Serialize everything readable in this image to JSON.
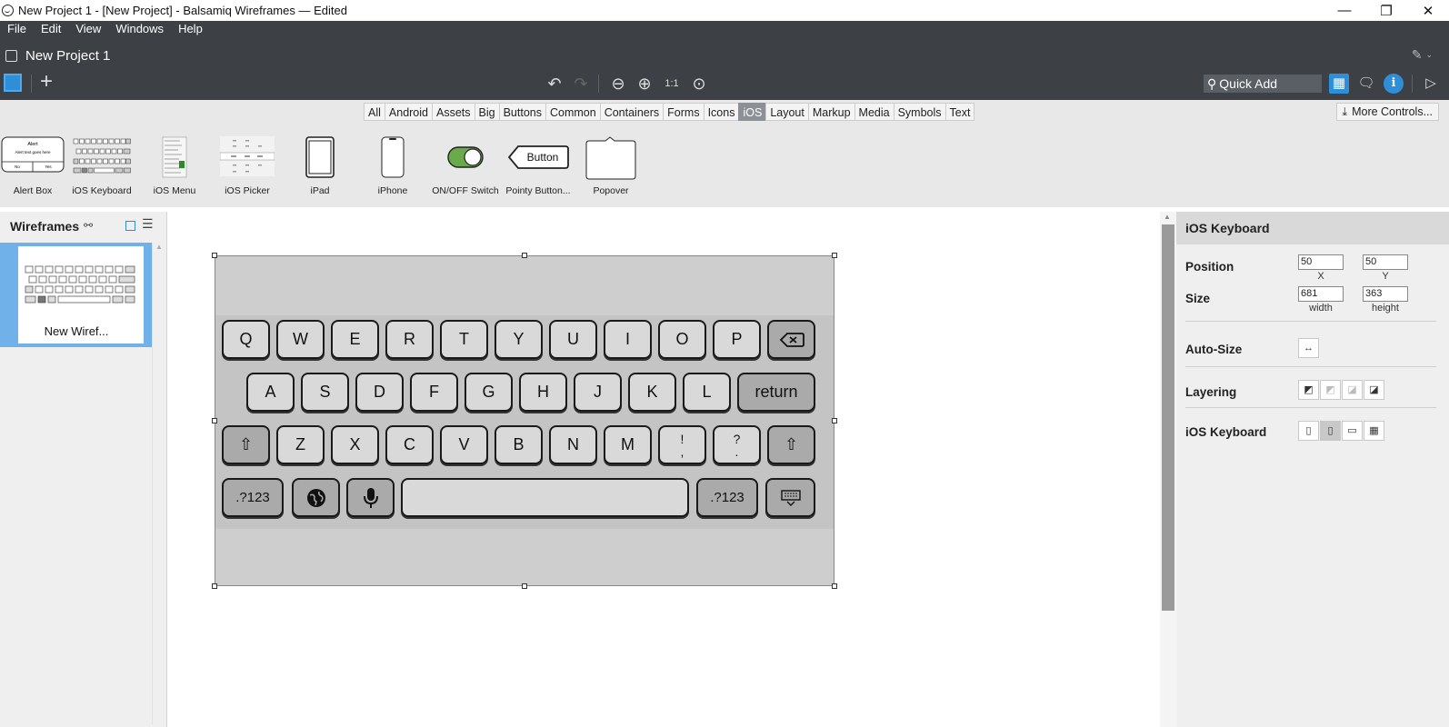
{
  "window": {
    "title": "New Project 1 - [New Project] - Balsamiq Wireframes — Edited",
    "controls": [
      "—",
      "❐",
      "✕"
    ]
  },
  "menu": [
    "File",
    "Edit",
    "View",
    "Windows",
    "Help"
  ],
  "project": {
    "title": "New Project 1"
  },
  "toolbar": {
    "quick_add_placeholder": "Quick Add",
    "icons": [
      "undo-icon",
      "redo-icon",
      "zoom-out-icon",
      "zoom-in-icon",
      "actual-size-icon",
      "fit-icon"
    ]
  },
  "categories": {
    "tabs": [
      "All",
      "Android",
      "Assets",
      "Big",
      "Buttons",
      "Common",
      "Containers",
      "Forms",
      "Icons",
      "iOS",
      "Layout",
      "Markup",
      "Media",
      "Symbols",
      "Text"
    ],
    "active": "iOS",
    "more_controls": "More Controls..."
  },
  "palette": [
    {
      "label": "Alert Box",
      "thumb_title": "Alert",
      "thumb_text": "Alert text goes here",
      "thumb_buttons": [
        "No",
        "Yes"
      ]
    },
    {
      "label": "iOS Keyboard"
    },
    {
      "label": "iOS Menu"
    },
    {
      "label": "iOS Picker"
    },
    {
      "label": "iPad"
    },
    {
      "label": "iPhone"
    },
    {
      "label": "ON/OFF Switch"
    },
    {
      "label": "Pointy Button...",
      "thumb_text": "Button"
    },
    {
      "label": "Popover"
    }
  ],
  "left_panel": {
    "title": "Wireframes",
    "items": [
      {
        "label": "New Wiref..."
      }
    ]
  },
  "keyboard": {
    "row1": [
      "Q",
      "W",
      "E",
      "R",
      "T",
      "Y",
      "U",
      "I",
      "O",
      "P"
    ],
    "row2": [
      "A",
      "S",
      "D",
      "F",
      "G",
      "H",
      "J",
      "K",
      "L"
    ],
    "return_label": "return",
    "row3": [
      "Z",
      "X",
      "C",
      "V",
      "B",
      "N",
      "M"
    ],
    "punct1": [
      "!",
      ","
    ],
    "punct2": [
      "?",
      "."
    ],
    "numbers_label": ".?123"
  },
  "inspector": {
    "title": "iOS Keyboard",
    "position_label": "Position",
    "x": "50",
    "y": "50",
    "x_label": "X",
    "y_label": "Y",
    "size_label": "Size",
    "width": "681",
    "height": "363",
    "width_label": "width",
    "height_label": "height",
    "autosize_label": "Auto-Size",
    "layering_label": "Layering",
    "variant_label": "iOS Keyboard"
  }
}
